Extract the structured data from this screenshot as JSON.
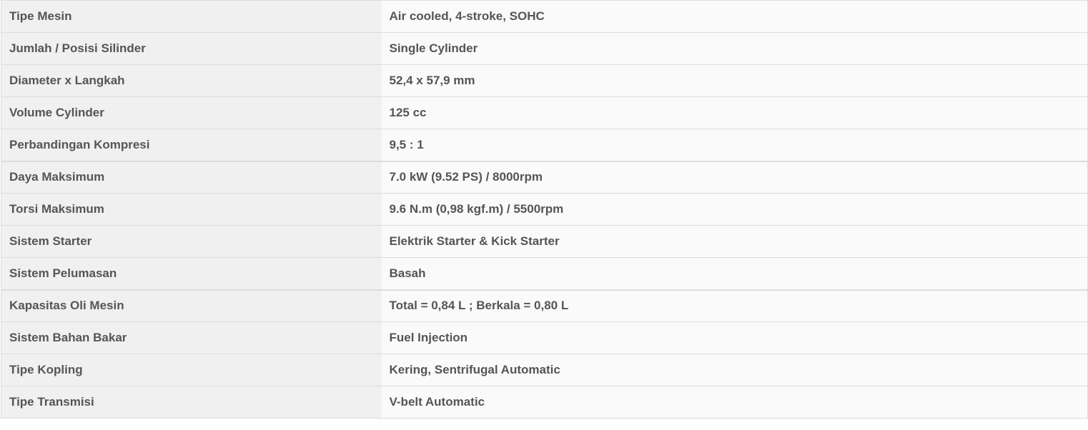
{
  "specs": [
    {
      "label": "Tipe Mesin",
      "value": "Air cooled, 4-stroke, SOHC"
    },
    {
      "label": "Jumlah / Posisi Silinder",
      "value": "Single Cylinder"
    },
    {
      "label": "Diameter x Langkah",
      "value": "52,4 x 57,9 mm"
    },
    {
      "label": "Volume Cylinder",
      "value": "125 cc"
    },
    {
      "label": "Perbandingan Kompresi",
      "value": "9,5 : 1"
    },
    {
      "label": "Daya Maksimum",
      "value": "7.0 kW (9.52 PS) / 8000rpm"
    },
    {
      "label": "Torsi Maksimum",
      "value": "9.6 N.m (0,98 kgf.m) / 5500rpm"
    },
    {
      "label": "Sistem Starter",
      "value": "Elektrik Starter & Kick Starter"
    },
    {
      "label": "Sistem Pelumasan",
      "value": "Basah"
    },
    {
      "label": "Kapasitas Oli Mesin",
      "value": "Total = 0,84 L ; Berkala = 0,80 L"
    },
    {
      "label": "Sistem Bahan Bakar",
      "value": "Fuel Injection"
    },
    {
      "label": "Tipe Kopling",
      "value": "Kering, Sentrifugal Automatic"
    },
    {
      "label": "Tipe Transmisi",
      "value": "V-belt Automatic"
    }
  ]
}
